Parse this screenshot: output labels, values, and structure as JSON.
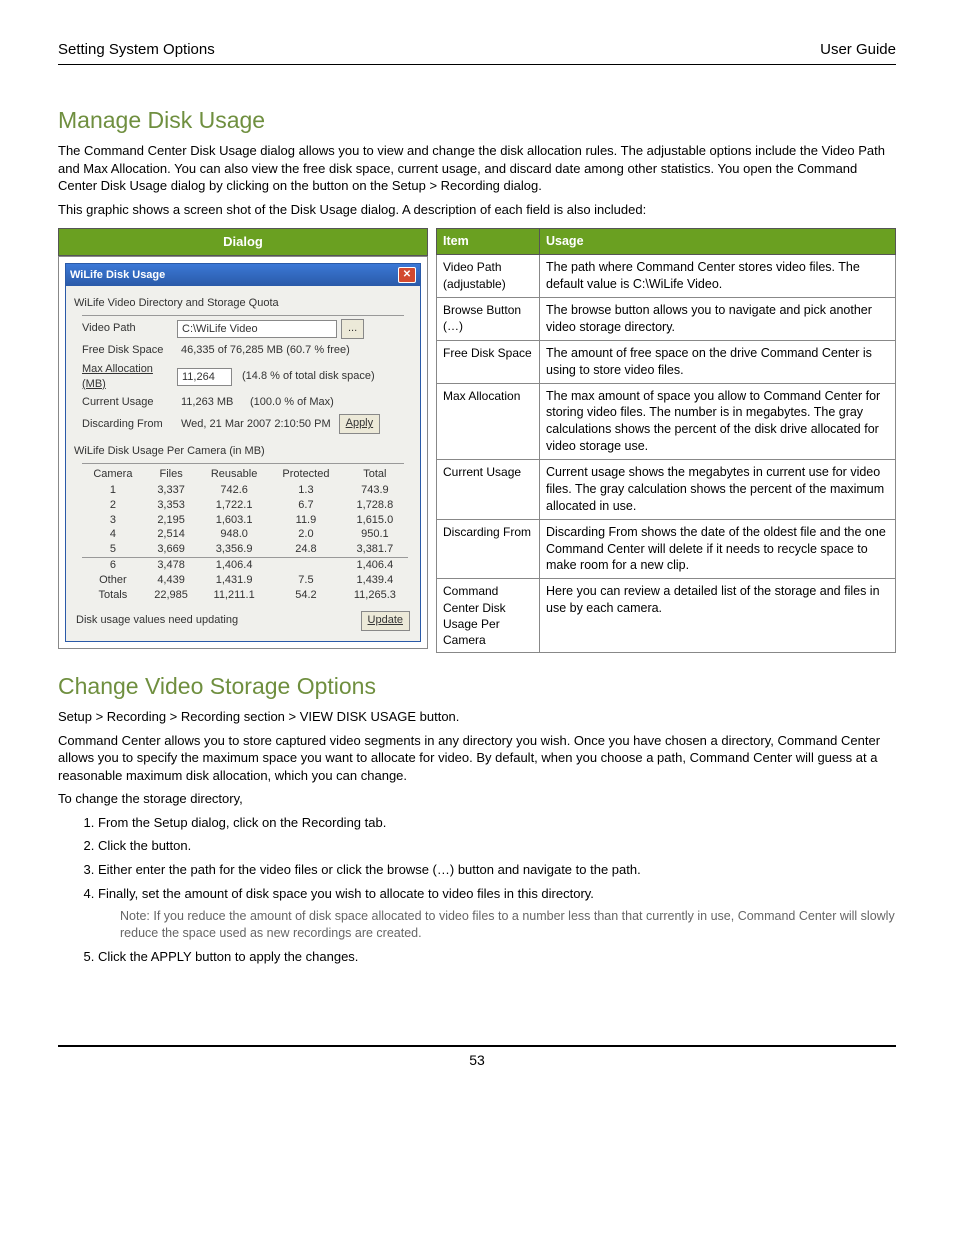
{
  "header": {
    "left": "Setting System Options",
    "right": "User Guide"
  },
  "section1": {
    "title": "Manage Disk Usage",
    "para1": "The Command Center Disk Usage dialog allows you to view and change the disk allocation rules. The adjustable options include the Video Path and Max Allocation. You can also view the free disk space, current usage, and discard date among other statistics. You open the Command Center Disk Usage dialog by clicking on the                               button on the Setup > Recording dialog.",
    "para2": "This graphic shows a screen shot of the Disk Usage dialog. A description of each field is also included:"
  },
  "dlgHeader": "Dialog",
  "descHead": {
    "item": "Item",
    "usage": "Usage"
  },
  "desc": [
    {
      "item": "Video Path (adjustable)",
      "usage": "The path where Command Center stores video files. The default value is C:\\WiLife Video."
    },
    {
      "item": "Browse Button (…)",
      "usage": "The browse button allows you to navigate and pick another video storage directory."
    },
    {
      "item": "Free Disk Space",
      "usage": "The amount of free space on the drive Command Center is using to store video files."
    },
    {
      "item": "Max Allocation",
      "usage": "The max amount of space you allow to Command Center for storing video files. The number is in megabytes. The gray calculations shows the percent of the disk drive allocated for video storage use."
    },
    {
      "item": "Current Usage",
      "usage": "Current usage shows the megabytes in current use for video files. The gray calculation shows the percent of the maximum allocated in use."
    },
    {
      "item": "Discarding From",
      "usage": "Discarding From shows the date of the oldest file and the one Command Center will delete if it needs to recycle space to make room for a new clip."
    },
    {
      "item": "Command Center Disk Usage Per Camera",
      "usage": "Here you can review a detailed list of the storage and files in use by each camera."
    }
  ],
  "dialog": {
    "title": "WiLife Disk Usage",
    "closeGlyph": "✕",
    "group1": "WiLife Video Directory and Storage Quota",
    "labels": {
      "videoPath": "Video Path",
      "freeDisk": "Free Disk Space",
      "maxAlloc": "Max Allocation (MB)",
      "currentUsage": "Current Usage",
      "discarding": "Discarding From"
    },
    "values": {
      "videoPath": "C:\\WiLife Video",
      "browse": "...",
      "freeDisk": "46,335 of 76,285 MB (60.7 % free)",
      "maxAlloc": "11,264",
      "maxAllocPct": "(14.8 % of total disk space)",
      "currentUsage": "11,263 MB",
      "currentUsagePct": "(100.0 % of Max)",
      "discarding": "Wed, 21 Mar 2007  2:10:50 PM",
      "apply": "Apply"
    },
    "group2": "WiLife Disk Usage Per Camera (in MB)",
    "usageHead": {
      "camera": "Camera",
      "files": "Files",
      "reusable": "Reusable",
      "protected": "Protected",
      "total": "Total"
    },
    "usageRows": [
      {
        "camera": "1",
        "files": "3,337",
        "reusable": "742.6",
        "protected": "1.3",
        "total": "743.9"
      },
      {
        "camera": "2",
        "files": "3,353",
        "reusable": "1,722.1",
        "protected": "6.7",
        "total": "1,728.8"
      },
      {
        "camera": "3",
        "files": "2,195",
        "reusable": "1,603.1",
        "protected": "11.9",
        "total": "1,615.0"
      },
      {
        "camera": "4",
        "files": "2,514",
        "reusable": "948.0",
        "protected": "2.0",
        "total": "950.1"
      },
      {
        "camera": "5",
        "files": "3,669",
        "reusable": "3,356.9",
        "protected": "24.8",
        "total": "3,381.7"
      },
      {
        "camera": "6",
        "files": "3,478",
        "reusable": "1,406.4",
        "protected": "",
        "total": "1,406.4"
      },
      {
        "camera": "Other",
        "files": "4,439",
        "reusable": "1,431.9",
        "protected": "7.5",
        "total": "1,439.4"
      },
      {
        "camera": "Totals",
        "files": "22,985",
        "reusable": "11,211.1",
        "protected": "54.2",
        "total": "11,265.3"
      }
    ],
    "updateNote": "Disk usage values need updating",
    "update": "Update"
  },
  "section2": {
    "title": "Change Video Storage Options",
    "path": "Setup > Recording > Recording section > VIEW DISK USAGE button.",
    "para1": "Command Center allows you to store captured video segments in any directory you wish. Once you have chosen a directory, Command Center allows you to specify the maximum space you want to allocate for video. By default, when you choose a path, Command Center will guess at a reasonable maximum disk allocation, which you can change.",
    "para2": "To change the storage directory,",
    "steps": [
      "From the Setup dialog, click on the Recording tab.",
      "Click the                                    button.",
      "Either enter the path for the video files or click the browse (…) button and navigate to the path.",
      "Finally, set the amount of disk space you wish to allocate to video files in this directory."
    ],
    "note": "Note: If you reduce the amount of disk space allocated to video files to a number less than that currently in use, Command Center will slowly reduce the space used as new recordings are created.",
    "step5": "Click the APPLY button to apply the changes."
  },
  "pageNumber": "53"
}
